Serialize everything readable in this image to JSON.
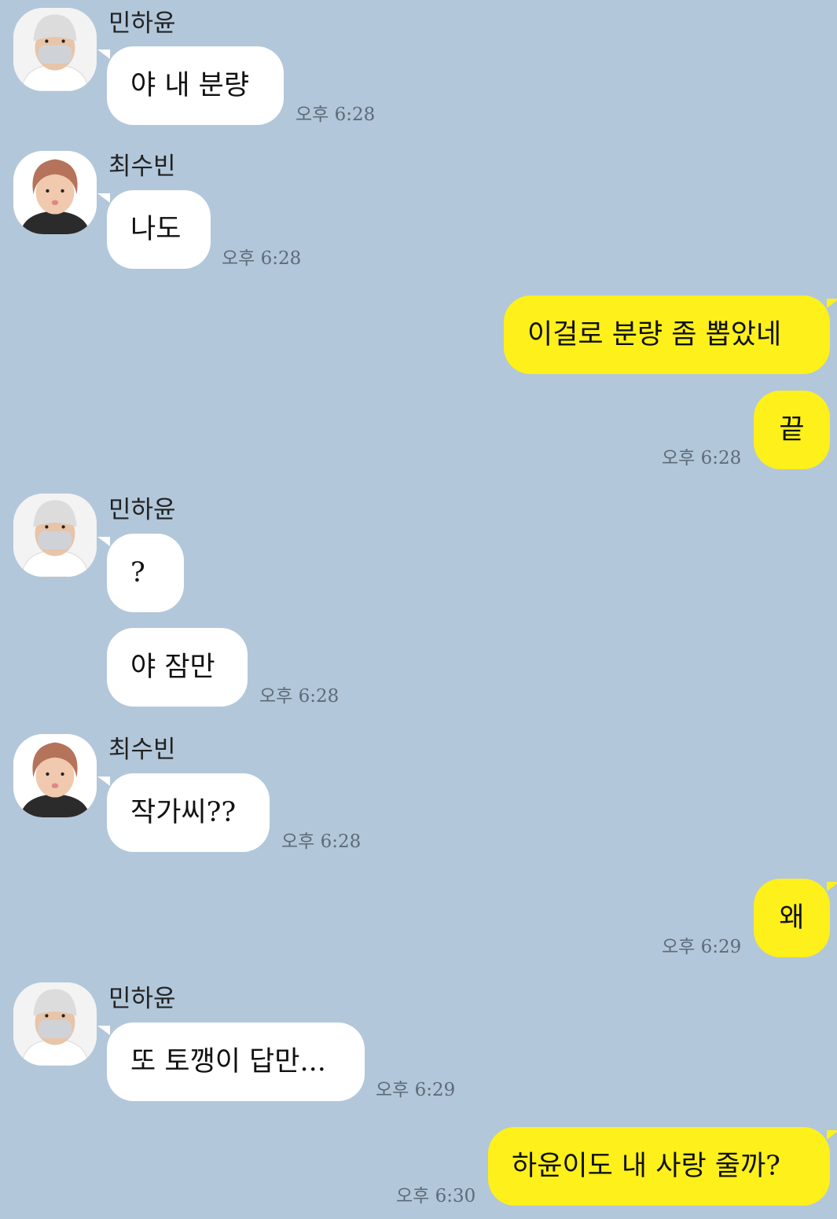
{
  "colors": {
    "background": "#b2c7da",
    "incoming_bubble": "#ffffff",
    "outgoing_bubble": "#fef01b",
    "timestamp": "#5e6b78"
  },
  "messages": [
    {
      "sender": "민하윤",
      "avatar": "avatar-icon-masked-white-beanie",
      "text": "야 내 분량",
      "time": "오후 6:28"
    },
    {
      "sender": "최수빈",
      "avatar": "avatar-icon-brown-hair",
      "text": "나도",
      "time": "오후 6:28"
    },
    {
      "text": "이걸로 분량 좀 뽑았네"
    },
    {
      "text": "끝",
      "time": "오후 6:28"
    },
    {
      "sender": "민하윤",
      "avatar": "avatar-icon-masked-white-beanie",
      "text": "?"
    },
    {
      "text": "야 잠만",
      "time": "오후 6:28"
    },
    {
      "sender": "최수빈",
      "avatar": "avatar-icon-brown-hair",
      "text": "작가씨??",
      "time": "오후 6:28"
    },
    {
      "text": "왜",
      "time": "오후 6:29"
    },
    {
      "sender": "민하윤",
      "avatar": "avatar-icon-masked-white-beanie",
      "text": "또 토깽이 답만...",
      "time": "오후 6:29"
    },
    {
      "text": "하윤이도 내 사랑 줄까?",
      "time": "오후 6:30"
    }
  ]
}
